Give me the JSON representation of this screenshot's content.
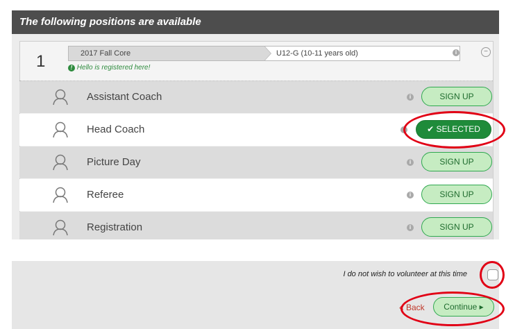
{
  "panel": {
    "header": "The following positions are available"
  },
  "group": {
    "number": "1",
    "season": "2017 Fall Core",
    "division": "U12-G (10-11 years old)",
    "registered_note": "Hello is registered here!",
    "collapse_icon": "minus-circle-icon"
  },
  "positions": [
    {
      "label": "Assistant Coach",
      "action": "SIGN UP",
      "selected": false
    },
    {
      "label": "Head Coach",
      "action": "SELECTED",
      "selected": true
    },
    {
      "label": "Picture Day",
      "action": "SIGN UP",
      "selected": false
    },
    {
      "label": "Referee",
      "action": "SIGN UP",
      "selected": false
    },
    {
      "label": "Registration",
      "action": "SIGN UP",
      "selected": false
    }
  ],
  "footer": {
    "decline_label": "I do not wish to volunteer at this time",
    "back_label": "« Back",
    "continue_label": "Continue ▸"
  },
  "colors": {
    "header_bg": "#4d4d4d",
    "signup_bg": "#c6ecc2",
    "selected_bg": "#1f8b3a",
    "annotation": "#e10015"
  }
}
